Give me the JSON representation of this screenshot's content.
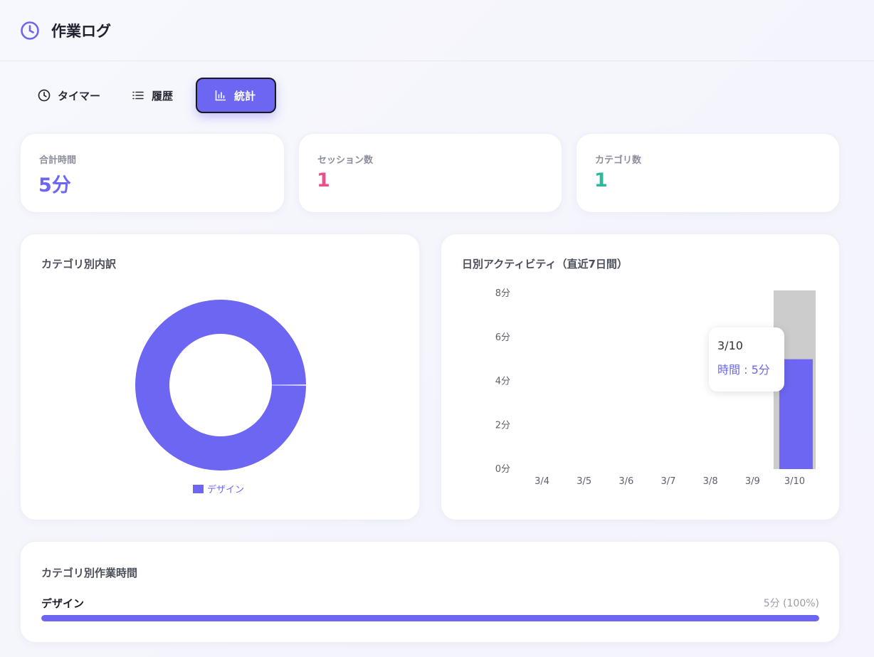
{
  "app": {
    "title": "作業ログ",
    "logo_icon": "clock-icon"
  },
  "tabs": [
    {
      "label": "タイマー",
      "icon": "clock-icon",
      "active": false
    },
    {
      "label": "履歴",
      "icon": "list-icon",
      "active": false
    },
    {
      "label": "統計",
      "icon": "bar-chart-icon",
      "active": true
    }
  ],
  "stats": [
    {
      "label": "合計時間",
      "value": "5分",
      "color": "#6c66f2"
    },
    {
      "label": "セッション数",
      "value": "1",
      "color": "#e8508f"
    },
    {
      "label": "カテゴリ数",
      "value": "1",
      "color": "#2fb89a"
    }
  ],
  "donut": {
    "title": "カテゴリ別内訳",
    "legend": "デザイン",
    "color": "#6c66f2"
  },
  "daily": {
    "title": "日別アクティビティ（直近7日間）",
    "tooltip": {
      "date": "3/10",
      "line": "時間 : 5分"
    }
  },
  "category_time": {
    "title": "カテゴリ別作業時間",
    "rows": [
      {
        "label": "デザイン",
        "value": "5分 (100%)",
        "fraction": 1.0
      }
    ]
  },
  "chart_data": [
    {
      "type": "pie",
      "title": "カテゴリ別内訳",
      "categories": [
        "デザイン"
      ],
      "values": [
        5
      ],
      "colors": [
        "#6c66f2"
      ]
    },
    {
      "type": "bar",
      "title": "日別アクティビティ（直近7日間）",
      "categories": [
        "3/4",
        "3/5",
        "3/6",
        "3/7",
        "3/8",
        "3/9",
        "3/10"
      ],
      "values": [
        0,
        0,
        0,
        0,
        0,
        0,
        5
      ],
      "ylim": [
        0,
        8
      ],
      "yticks": [
        "0分",
        "2分",
        "4分",
        "6分",
        "8分"
      ],
      "ytick_values": [
        0,
        2,
        4,
        6,
        8
      ],
      "highlight": "3/10",
      "colors": {
        "bar": "#6c66f2",
        "hover": "#cccccc"
      }
    }
  ]
}
